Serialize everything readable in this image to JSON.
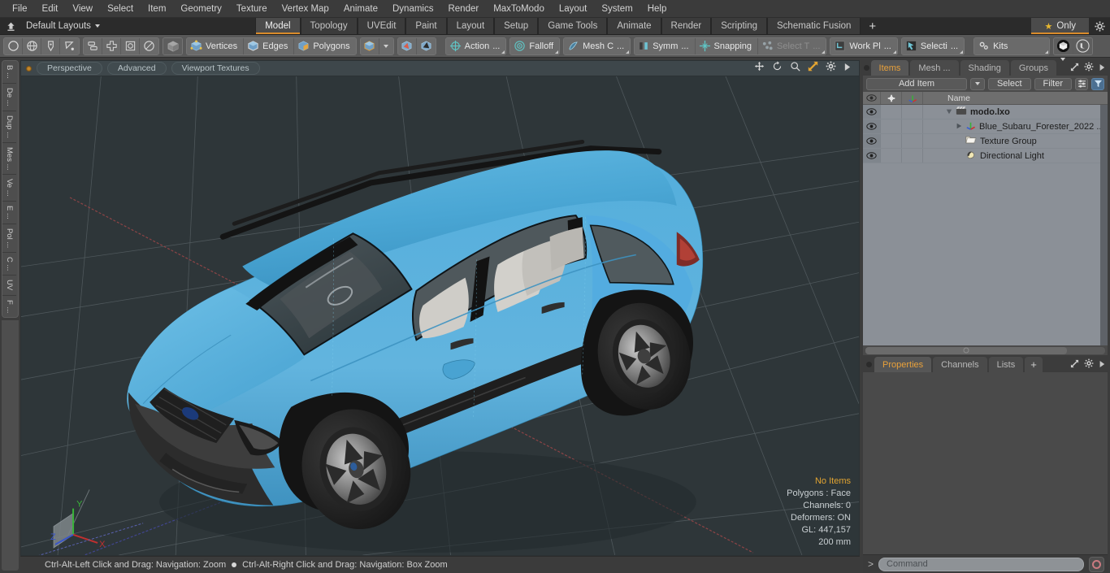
{
  "app": {
    "title": "modo"
  },
  "menubar": {
    "items": [
      "File",
      "Edit",
      "View",
      "Select",
      "Item",
      "Geometry",
      "Texture",
      "Vertex Map",
      "Animate",
      "Dynamics",
      "Render",
      "MaxToModo",
      "Layout",
      "System",
      "Help"
    ]
  },
  "layoutbar": {
    "home_icon": "home-icon",
    "layout_menu": "Default Layouts",
    "tabs": [
      {
        "label": "Model",
        "active": true
      },
      {
        "label": "Topology",
        "active": false
      },
      {
        "label": "UVEdit",
        "active": false
      },
      {
        "label": "Paint",
        "active": false
      },
      {
        "label": "Layout",
        "active": false
      },
      {
        "label": "Setup",
        "active": false
      },
      {
        "label": "Game Tools",
        "active": false
      },
      {
        "label": "Animate",
        "active": false
      },
      {
        "label": "Render",
        "active": false
      },
      {
        "label": "Scripting",
        "active": false
      },
      {
        "label": "Schematic Fusion",
        "active": false
      }
    ],
    "add_tab": "+",
    "only_label": "Only",
    "star_icon": "star-icon",
    "gear_icon": "gear-icon"
  },
  "toolbar": {
    "group1": [
      "circle-icon",
      "globe-icon",
      "pen-icon",
      "curve-icon"
    ],
    "group2": [
      "duplicate-icon",
      "plus-shape-icon",
      "bevel-icon",
      "radial-icon"
    ],
    "group3": [
      "cube-icon"
    ],
    "selection_modes": [
      {
        "label": "Vertices",
        "icon": "vertices-cube-icon"
      },
      {
        "label": "Edges",
        "icon": "edges-cube-icon"
      },
      {
        "label": "Polygons",
        "icon": "polygons-cube-icon"
      }
    ],
    "mode_extra": {
      "icon": "cube-icon",
      "caret": "chevron-down-icon"
    },
    "group4": [
      "material-cube-icon",
      "part-cube-icon"
    ],
    "tools": [
      {
        "label": "Action",
        "suffix": "...",
        "icon": "action-center-icon"
      },
      {
        "label": "Falloff",
        "suffix": "",
        "icon": "falloff-icon"
      },
      {
        "label": "Mesh C",
        "suffix": "...",
        "icon": "mesh-constraint-icon"
      },
      {
        "label": "Symm",
        "suffix": "...",
        "icon": "symmetry-icon"
      },
      {
        "label": "Snapping",
        "suffix": "",
        "icon": "snapping-icon"
      },
      {
        "label": "Select T",
        "suffix": "...",
        "icon": "select-through-icon",
        "dim": true
      },
      {
        "label": "Work Pl",
        "suffix": "...",
        "icon": "work-plane-icon"
      },
      {
        "label": "Selecti",
        "suffix": "...",
        "icon": "selection-set-icon"
      },
      {
        "label": "Kits",
        "suffix": "",
        "icon": "kits-gears-icon"
      }
    ],
    "right_icons": [
      "modo-badge-icon",
      "unreal-badge-icon"
    ]
  },
  "left_tabs": [
    "B ...",
    "De ...",
    "Dup ...",
    "Mes ...",
    "Ve ...",
    "E ...",
    "Pol ...",
    "C ...",
    "UV",
    "F ..."
  ],
  "viewport": {
    "indicator": "active-dot",
    "buttons": [
      "Perspective",
      "Advanced",
      "Viewport Textures"
    ],
    "icons": [
      "move-icon",
      "rotate-icon",
      "zoom-icon",
      "fit-expand-icon",
      "gear-icon",
      "play-arrow-icon"
    ],
    "stats": {
      "items_label": "No Items",
      "polygons": "Polygons : Face",
      "channels": "Channels: 0",
      "deformers": "Deformers: ON",
      "gl": "GL: 447,157",
      "scale": "200 mm"
    },
    "axis_gizmo": {
      "x": "X",
      "y": "Y",
      "z": "Z"
    },
    "colors": {
      "background": "#2e3639",
      "grid": "#5c6569",
      "axis_x": "#8c4243",
      "axis_z": "#4a4f8c",
      "car_body": "#4aa8d8",
      "car_body_shadow": "#2e7ba5",
      "car_glass": "#3b4448",
      "car_interior": "#c8c8c4",
      "car_tire": "#1c1c1c",
      "car_trim": "#151515"
    }
  },
  "statusbar": {
    "left": "Ctrl-Alt-Left Click and Drag: Navigation: Zoom",
    "right": "Ctrl-Alt-Right Click and Drag: Navigation: Box Zoom"
  },
  "right_panel": {
    "top_tabs": [
      {
        "label": "Items",
        "active": true
      },
      {
        "label": "Mesh ...",
        "active": false
      },
      {
        "label": "Shading",
        "active": false
      },
      {
        "label": "Groups",
        "active": false
      }
    ],
    "top_tab_icons": [
      "chevron-down-icon",
      "expand-icon",
      "gear-icon",
      "play-arrow-icon"
    ],
    "item_toolbar": {
      "add_item": "Add Item",
      "add_item_caret": "chevron-down-icon",
      "select": "Select",
      "filter": "Filter",
      "list_icon": "list-options-icon",
      "funnel_icon": "funnel-icon"
    },
    "tree": {
      "columns": [
        "eye-icon",
        "lock-plus-icon",
        "axis-icon",
        "Name"
      ],
      "rows": [
        {
          "name": "modo.lxo",
          "icon": "scene-clapper-icon",
          "bold": true,
          "indent": 0,
          "twirl": "down"
        },
        {
          "name": "Blue_Subaru_Forester_2022 ...",
          "icon": "mesh-axis-icon",
          "bold": false,
          "indent": 1,
          "twirl": "right"
        },
        {
          "name": "Texture Group",
          "icon": "folder-icon",
          "bold": false,
          "indent": 1,
          "twirl": "none"
        },
        {
          "name": "Directional Light",
          "icon": "light-icon",
          "bold": false,
          "indent": 1,
          "twirl": "none"
        }
      ]
    },
    "bottom_tabs": [
      {
        "label": "Properties",
        "active": true
      },
      {
        "label": "Channels",
        "active": false
      },
      {
        "label": "Lists",
        "active": false
      },
      {
        "label": "+",
        "active": false
      }
    ],
    "bottom_tab_icons": [
      "expand-icon",
      "gear-icon",
      "play-arrow-icon"
    ]
  },
  "command_bar": {
    "prompt": ">",
    "placeholder": "Command",
    "value": "",
    "record_icon": "record-icon"
  }
}
